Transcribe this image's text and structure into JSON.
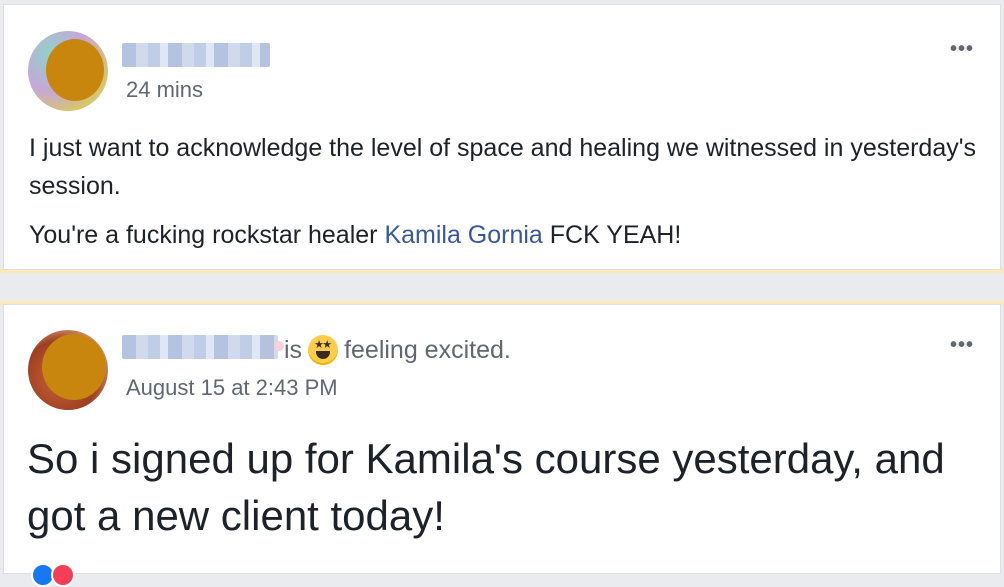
{
  "colors": {
    "page_bg": "#e9ebee",
    "card_bg": "#ffffff",
    "link": "#385898",
    "meta_text": "#606770",
    "highlight": "#fde9b8"
  },
  "posts": [
    {
      "author_name": "",
      "timestamp": "24 mins",
      "more_icon": "•••",
      "paragraphs": [
        "I just want to acknowledge the level of space and healing we witnessed in yesterday's session."
      ],
      "line2_before": "You're a fucking rockstar healer ",
      "line2_mention": "Kamila Gornia",
      "line2_after": " FCK YEAH!"
    },
    {
      "author_name": "",
      "feeling_prefix": "is",
      "feeling_emoji": "star-struck-emoji",
      "feeling_text": "feeling excited.",
      "timestamp": "August 15 at 2:43 PM",
      "more_icon": "•••",
      "body": "So i signed up for Kamila's course yesterday, and got a new client today!",
      "reactions": [
        "like-icon",
        "love-icon"
      ]
    }
  ]
}
